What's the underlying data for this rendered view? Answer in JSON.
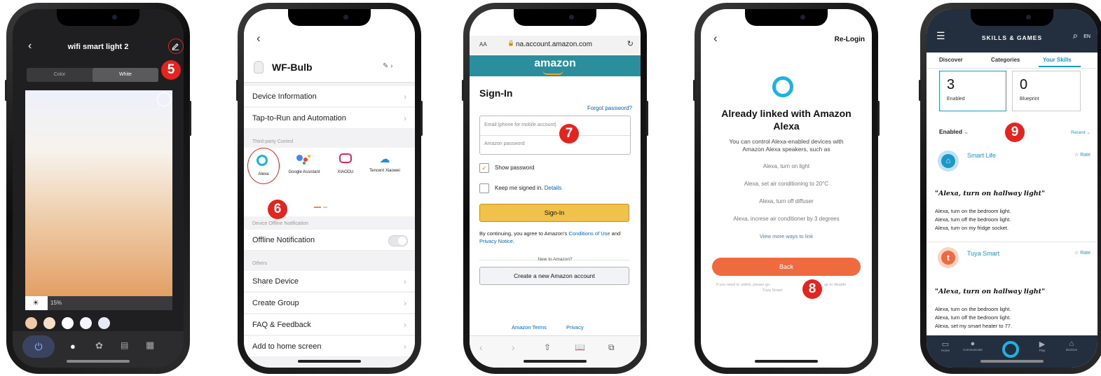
{
  "badges": [
    "5",
    "6",
    "7",
    "8",
    "9"
  ],
  "p1": {
    "title": "wifi smart light 2",
    "tab_color": "Color",
    "tab_white": "White",
    "brightness": "15%",
    "brightness_value": 15,
    "swatches": [
      "#f0c9a6",
      "#f5ddc6",
      "#ffffff",
      "#f4f6fb",
      "#e6eaf4"
    ]
  },
  "p2": {
    "device_name": "WF-Bulb",
    "rows_top": [
      "Device Information",
      "Tap-to-Run and Automation"
    ],
    "third_party_label": "Third-party Control",
    "integrations": [
      "Alexa",
      "Google Assistant",
      "XIAODU",
      "Tencent Xiaowei"
    ],
    "offline_label": "Device Offline Notification",
    "offline_row": "Offline Notification",
    "others_label": "Others",
    "rows_bottom": [
      "Share Device",
      "Create Group",
      "FAQ & Feedback",
      "Add to home screen"
    ]
  },
  "p3": {
    "text_size": "AA",
    "url": "na.account.amazon.com",
    "logo": "amazon",
    "heading": "Sign-In",
    "forgot": "Forgot password?",
    "email_placeholder": "Email (phone for mobile account)",
    "password_placeholder": "Amazon password",
    "show_password": "Show password",
    "keep_signed": "Keep me signed in.",
    "details": "Details",
    "signin_button": "Sign-In",
    "terms_pre": "By continuing, you agree to Amazon's",
    "terms_link1": "Conditions of Use",
    "terms_and": "and",
    "terms_link2": "Privacy Notice",
    "terms_end": ".",
    "new_to": "New to Amazon?",
    "create_button": "Create a new Amazon account",
    "footer_terms": "Amazon Terms",
    "footer_privacy": "Privacy"
  },
  "p4": {
    "relogin": "Re-Login",
    "heading": "Already linked with Amazon Alexa",
    "desc": "You can control Alexa-enabled devices with Amazon Alexa speakers, such as",
    "examples": [
      "Alexa, turn on light",
      "Alexa, set air conditioning to 20°C",
      "Alexa, turn off diffuser",
      "Alexa, increse air conditioner by 3 degrees"
    ],
    "more": "View more ways to link",
    "back_button": "Back",
    "note_left": "If you need to unlink, please go",
    "note_right": "ap to disable",
    "note_line2": "Tuya Smart"
  },
  "p5": {
    "header_title": "SKILLS & GAMES",
    "lang": "EN",
    "tabs": [
      "Discover",
      "Categories",
      "Your Skills"
    ],
    "enabled_count": "3",
    "enabled_label": "Enabled",
    "blueprint_count": "0",
    "blueprint_label": "Blueprint",
    "filter": "Enabled",
    "sort": "Recent",
    "skills": [
      {
        "name": "Smart Life",
        "rate": "Rate",
        "quote": "\"Alexa, turn on hallway light\"",
        "lines": [
          "Alexa, turn on the bedroom light.",
          "Alexa, turn off the bedroom light.",
          "Alexa, turn on my fridge socket."
        ]
      },
      {
        "name": "Tuya Smart",
        "rate": "Rate",
        "quote": "\"Alexa, turn on hallway light\"",
        "lines": [
          "Alexa, turn on the bedroom light.",
          "Alexa, turn off the bedroom light.",
          "Alexa, set my smart heater to 77."
        ]
      }
    ],
    "nav": [
      "Home",
      "Communicate",
      "",
      "Play",
      "Devices"
    ]
  },
  "colors": {
    "badge": "#e52420",
    "amazon_teal": "#2a8e9c",
    "amazon_button": "#f0c14b",
    "tuya_back": "#ef6a3f",
    "alexa_blue": "#1ab3e6",
    "alexa_nav": "#232f3e"
  }
}
